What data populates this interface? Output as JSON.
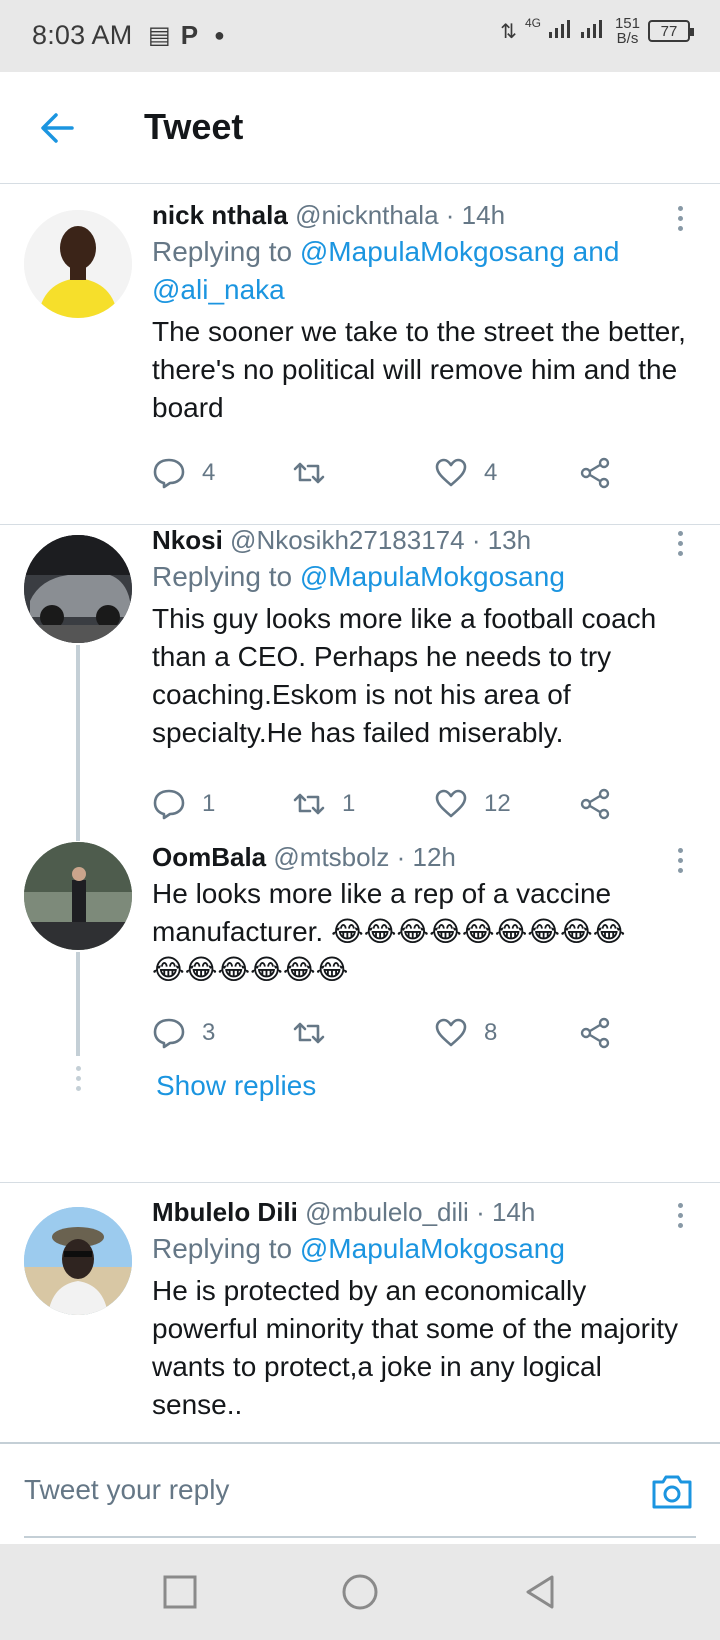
{
  "status_bar": {
    "time": "8:03 AM",
    "network": "4G",
    "speed_value": "151",
    "speed_unit": "B/s",
    "battery": "77"
  },
  "header": {
    "title": "Tweet",
    "back_icon": "arrow-left-icon"
  },
  "colors": {
    "accent": "#1b95e0",
    "text": "#14171a",
    "secondary": "#657786",
    "divider": "#d6dde3"
  },
  "tweets": [
    {
      "name": "nick nthala",
      "handle": "@nicknthala",
      "time": "· 14h",
      "replying_prefix": "Replying to",
      "replying_to": "@MapulaMokgosang and",
      "replying_to_2": "@ali_naka",
      "text": "The sooner we take to the street the better, there's no political will remove him and the board",
      "replies": "4",
      "retweets": "",
      "likes": "4"
    },
    {
      "name": "Nkosi",
      "handle": "@Nkosikh27183174",
      "time": "· 13h",
      "replying_prefix": "Replying to",
      "replying_to": "@MapulaMokgosang",
      "text": "This guy looks more like a football coach than a CEO. Perhaps he needs to try coaching.Eskom is not his area of specialty.He has failed miserably.",
      "replies": "1",
      "retweets": "1",
      "likes": "12"
    },
    {
      "name": "OomBala",
      "handle": "@mtsbolz",
      "time": "· 12h",
      "text_line1": "He looks more like a rep of a vaccine",
      "text_line2": "manufacturer. 😂😂😂😂😂😂😂😂😂",
      "text_line3": "😂😂😂😂😂😂",
      "replies": "3",
      "retweets": "",
      "likes": "8",
      "show_replies": "Show replies"
    },
    {
      "name": "Mbulelo Dili",
      "handle": "@mbulelo_dili",
      "time": "· 14h",
      "replying_prefix": "Replying to",
      "replying_to": "@MapulaMokgosang",
      "text": "He is protected by an economically powerful minority that some of the majority wants to protect,a joke in any logical sense.."
    }
  ],
  "reply_bar": {
    "placeholder": "Tweet your reply",
    "camera_icon": "camera-icon"
  }
}
